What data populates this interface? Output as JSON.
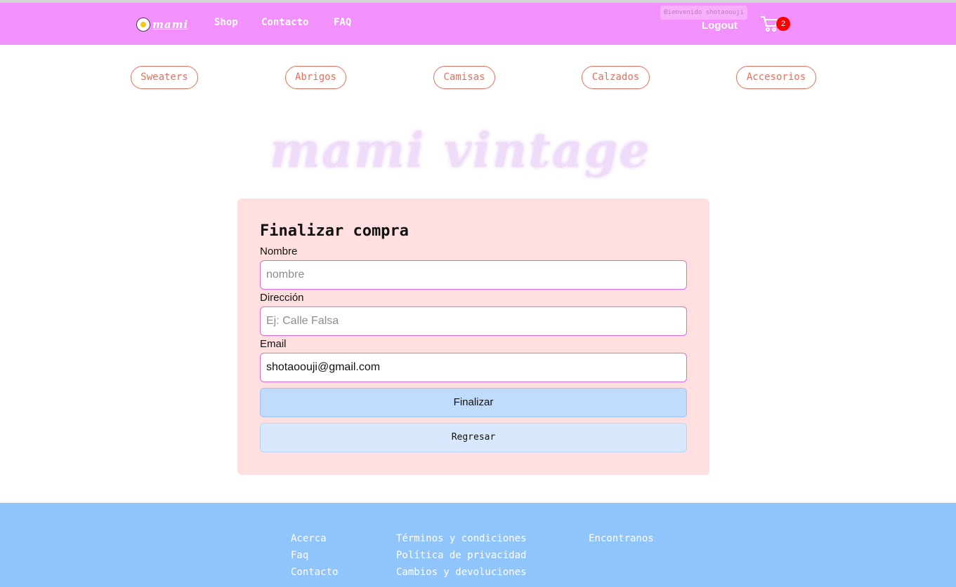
{
  "header": {
    "logo_text": "mami",
    "nav": [
      "Shop",
      "Contacto",
      "FAQ"
    ],
    "welcome": "Bienvenido shotaoouji",
    "logout": "Logout",
    "cart_count": "2"
  },
  "categories": [
    "Sweaters",
    "Abrigos",
    "Camisas",
    "Calzados",
    "Accesorios"
  ],
  "banner_text": "mami vintage",
  "form": {
    "title": "Finalizar compra",
    "name_label": "Nombre",
    "name_placeholder": "nombre",
    "name_value": "",
    "address_label": "Dirección",
    "address_placeholder": "Ej: Calle Falsa",
    "address_value": "",
    "email_label": "Email",
    "email_value": "shotaoouji@gmail.com",
    "submit_label": "Finalizar",
    "back_label": "Regresar"
  },
  "footer": {
    "col1": [
      "Acerca",
      "Faq",
      "Contacto"
    ],
    "col2": [
      "Términos y condiciones",
      "Política de privacidad",
      "Cambios y devoluciones"
    ],
    "col3": [
      "Encontranos"
    ]
  },
  "colors": {
    "navbar": "#f290fc",
    "category_accent": "#e86d5d",
    "card_bg": "#ffdfe0",
    "footer": "#90c5fc",
    "badge": "#ff0000"
  },
  "icons": {
    "logo": "fried-egg-icon",
    "cart": "shopping-cart-icon"
  }
}
